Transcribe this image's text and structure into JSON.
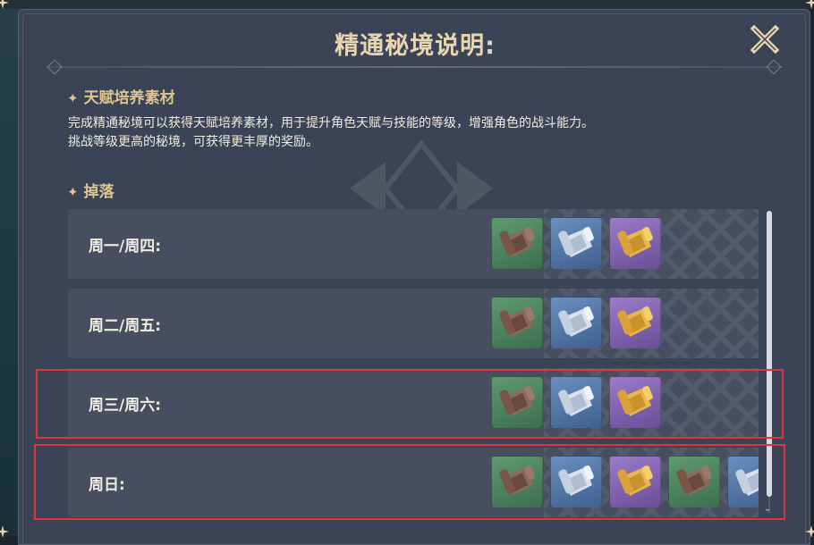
{
  "dialog": {
    "title": "精通秘境说明:",
    "close_icon": "close-icon"
  },
  "sections": {
    "talent": {
      "heading": "天赋培养素材",
      "description_line1": "完成精通秘境可以获得天赋培养素材，用于提升角色天赋与技能的等级，增强角色的战斗能力。",
      "description_line2": "挑战等级更高的秘境，可获得更丰厚的奖励。"
    },
    "drops": {
      "heading": "掉落"
    }
  },
  "drop_rows": [
    {
      "label": "周一/周四:",
      "items": [
        "green-scroll",
        "blue-scroll",
        "purple-scroll"
      ]
    },
    {
      "label": "周二/周五:",
      "items": [
        "green-scroll",
        "blue-scroll",
        "purple-scroll"
      ]
    },
    {
      "label": "周三/周六:",
      "items": [
        "green-scroll",
        "blue-scroll",
        "purple-scroll"
      ]
    },
    {
      "label": "周日:",
      "items": [
        "green-scroll",
        "blue-scroll",
        "purple-scroll",
        "green-scroll",
        "blue-scroll"
      ]
    }
  ],
  "colors": {
    "panel_bg": "#3b4356",
    "row_bg": "#464e60",
    "title": "#e8d7ae",
    "heading": "#dcc58e",
    "text": "#f1ede2",
    "highlight": "#e3343a",
    "rarity_green": "#4f8a5e",
    "rarity_blue": "#5579ab",
    "rarity_purple": "#8466b6"
  }
}
